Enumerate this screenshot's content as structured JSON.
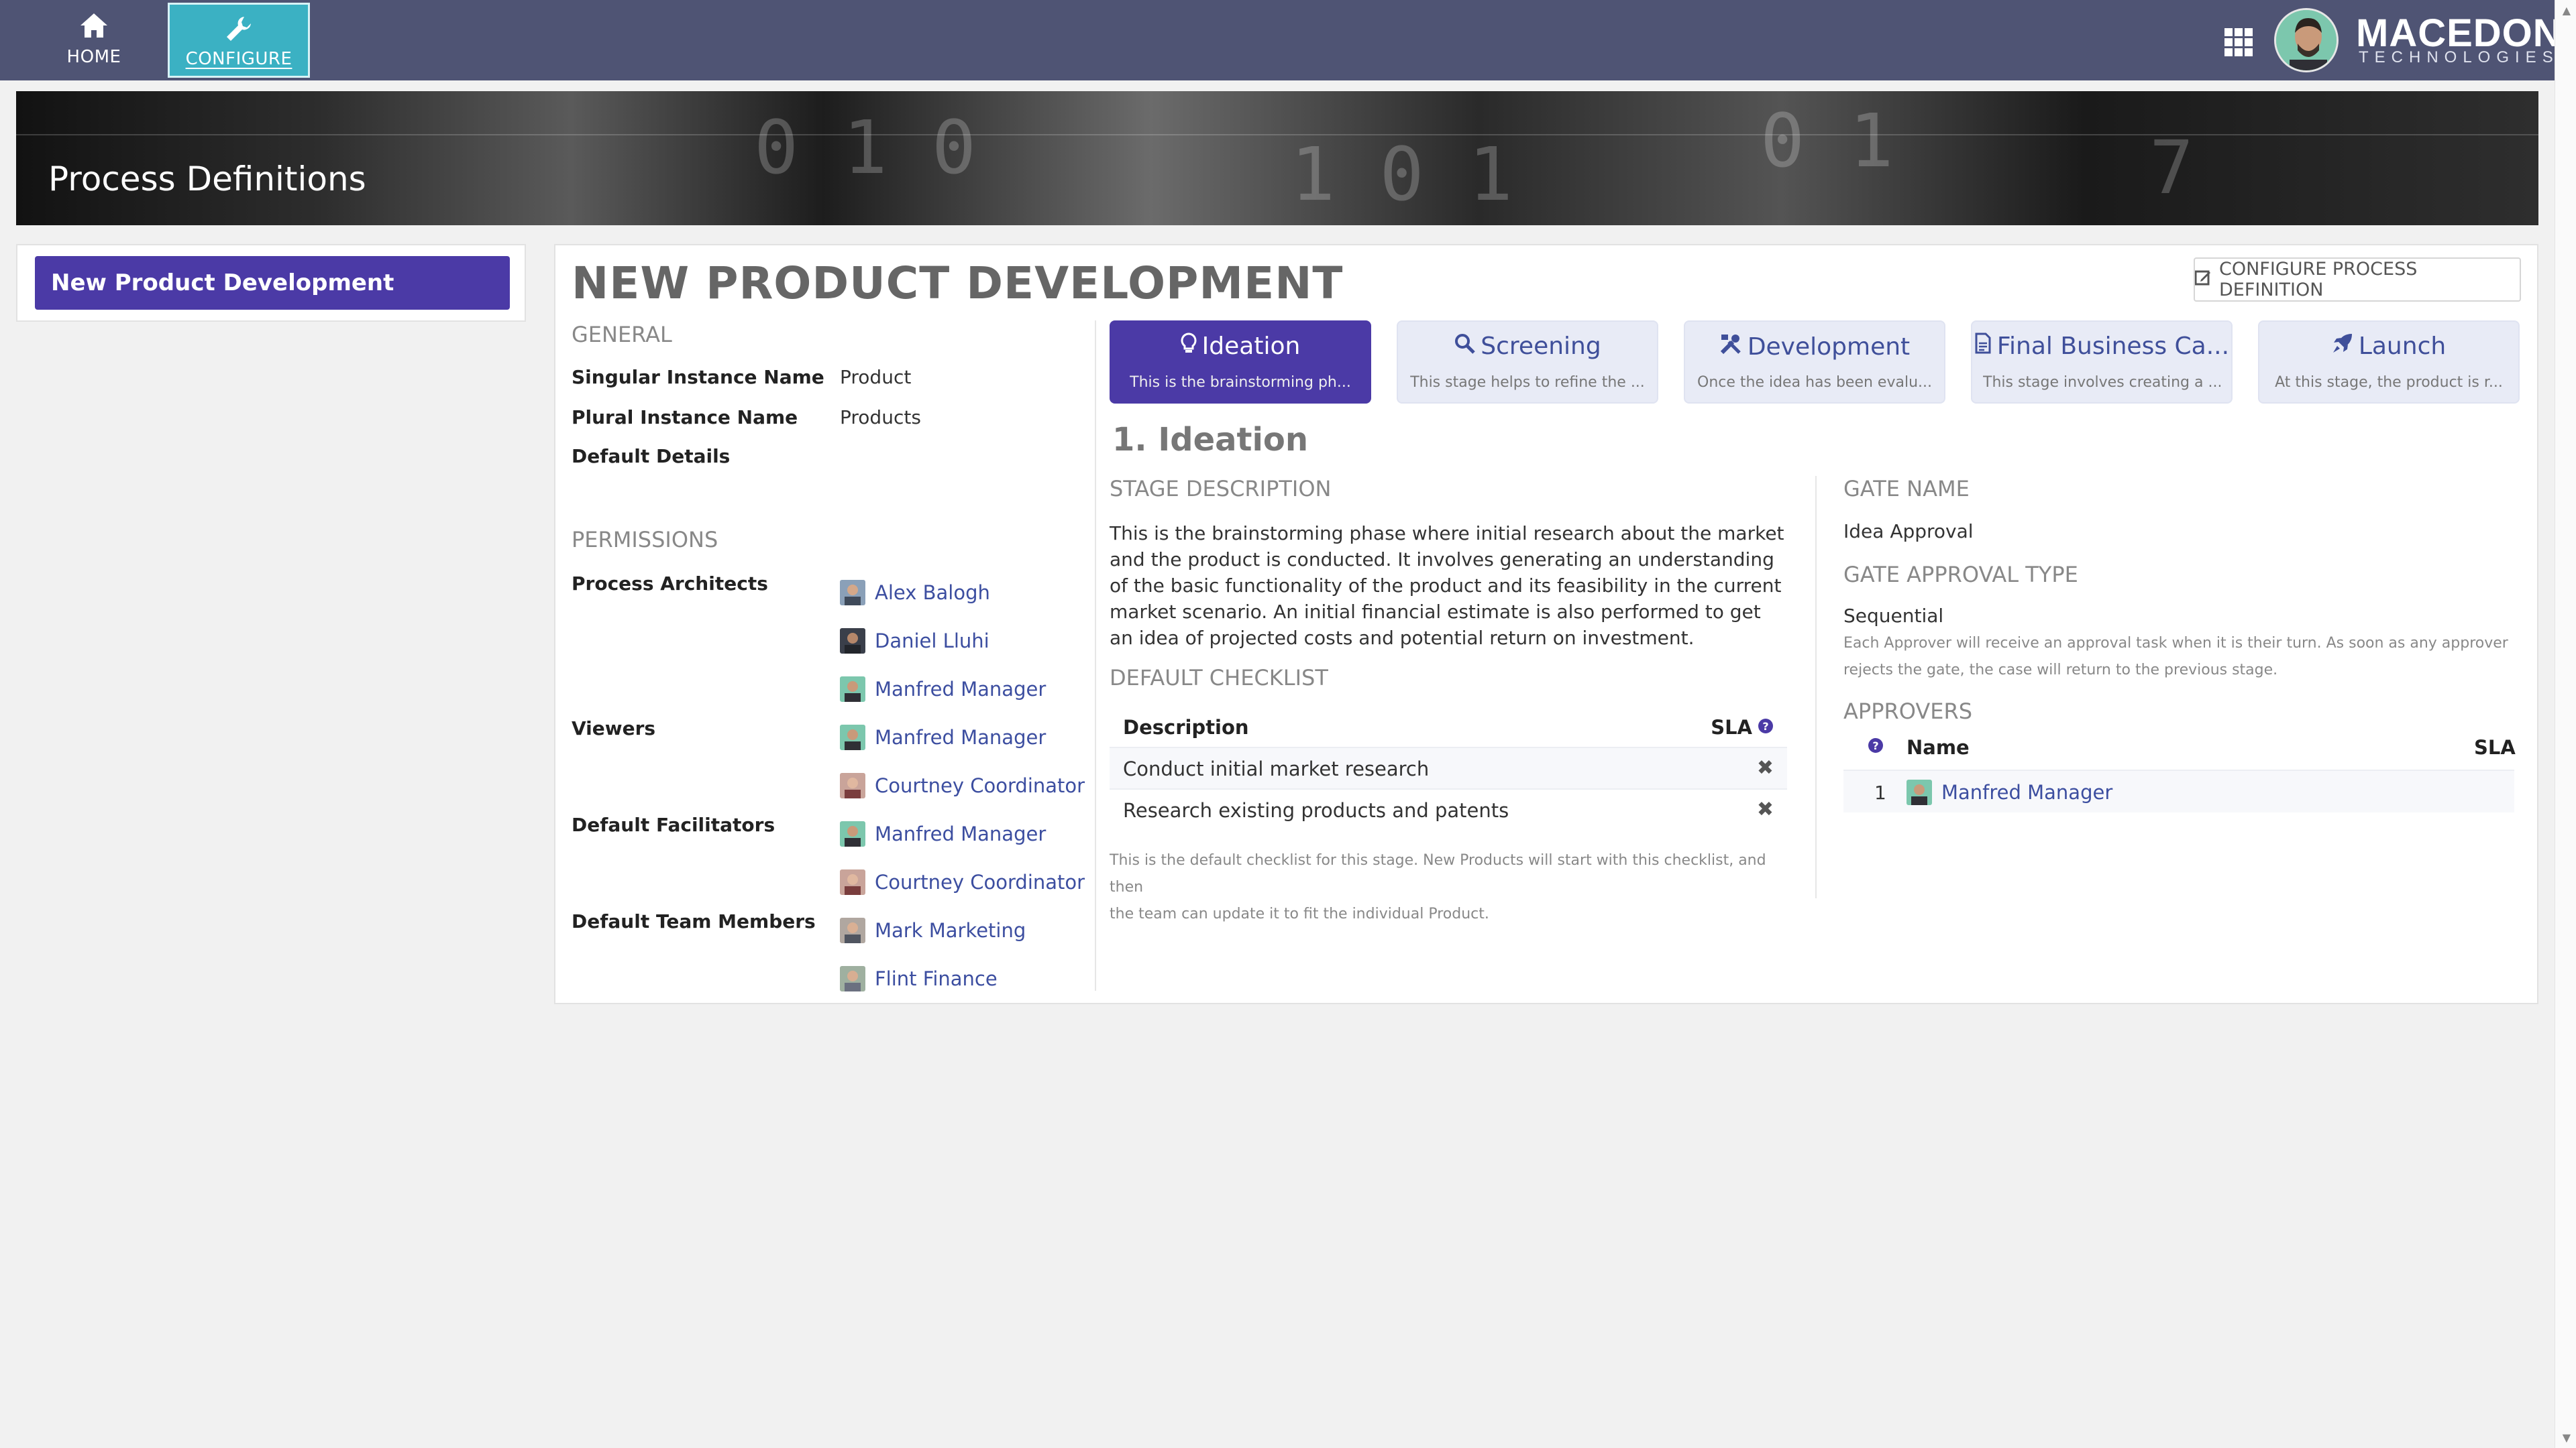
{
  "nav": {
    "home_label": "HOME",
    "configure_label": "CONFIGURE"
  },
  "brand": {
    "name": "MACEDON",
    "sub": "TECHNOLOGIES"
  },
  "banner": {
    "title": "Process Definitions"
  },
  "sidebar": {
    "items": [
      {
        "label": "New Product Development",
        "active": true
      }
    ]
  },
  "main": {
    "title": "NEW PRODUCT DEVELOPMENT",
    "configure_button": "CONFIGURE PROCESS DEFINITION",
    "general": {
      "heading": "GENERAL",
      "singular_label": "Singular Instance Name",
      "singular_value": "Product",
      "plural_label": "Plural Instance Name",
      "plural_value": "Products",
      "details_label": "Default Details"
    },
    "permissions": {
      "heading": "PERMISSIONS",
      "groups": [
        {
          "label": "Process Architects",
          "people": [
            "Alex Balogh",
            "Daniel Lluhi",
            "Manfred Manager"
          ]
        },
        {
          "label": "Viewers",
          "people": [
            "Manfred Manager",
            "Courtney Coordinator"
          ]
        },
        {
          "label": "Default Facilitators",
          "people": [
            "Manfred Manager",
            "Courtney Coordinator"
          ]
        },
        {
          "label": "Default Team Members",
          "people": [
            "Mark Marketing",
            "Flint Finance"
          ]
        }
      ]
    },
    "stages": [
      {
        "title": "Ideation",
        "desc": "This is the brainstorming ph...",
        "icon": "lightbulb-icon",
        "active": true
      },
      {
        "title": "Screening",
        "desc": "This stage helps to refine the ...",
        "icon": "search-icon",
        "active": false
      },
      {
        "title": "Development",
        "desc": "Once the idea has been evalu...",
        "icon": "tools-icon",
        "active": false
      },
      {
        "title": "Final Business Ca...",
        "desc": "This stage involves creating a ...",
        "icon": "document-icon",
        "active": false
      },
      {
        "title": "Launch",
        "desc": "At this stage, the product is r...",
        "icon": "rocket-icon",
        "active": false
      }
    ],
    "stage_detail": {
      "heading": "1. Ideation",
      "desc_heading": "STAGE DESCRIPTION",
      "description": "This is the brainstorming phase where initial research about the market and the product is conducted. It involves generating an understanding of the basic functionality of the product and its feasibility in the current market scenario. An initial financial estimate is also performed to get an idea of projected costs and potential return on investment.",
      "checklist_heading": "DEFAULT CHECKLIST",
      "checklist_col_desc": "Description",
      "checklist_col_sla": "SLA",
      "checklist": [
        "Conduct initial market research",
        "Research existing products and patents"
      ],
      "checklist_note_1": "This is the default checklist for this stage. New Products will start with this checklist, and then",
      "checklist_note_2": "the team can update it to fit the individual Product.",
      "gate_name_heading": "GATE NAME",
      "gate_name": "Idea Approval",
      "gate_type_heading": "GATE APPROVAL TYPE",
      "gate_type": "Sequential",
      "gate_type_note_1": "Each Approver will receive an approval task when it is their turn. As soon as any approver",
      "gate_type_note_2": "rejects the gate, the case will return to the previous stage.",
      "approvers_heading": "APPROVERS",
      "approvers_col_name": "Name",
      "approvers_col_sla": "SLA",
      "approvers": [
        {
          "order": "1",
          "name": "Manfred Manager"
        }
      ]
    }
  },
  "colors": {
    "topbar": "#4f5474",
    "configure_active": "#3bb1c3",
    "primary": "#4b3aa6",
    "link": "#3c4ea0"
  }
}
